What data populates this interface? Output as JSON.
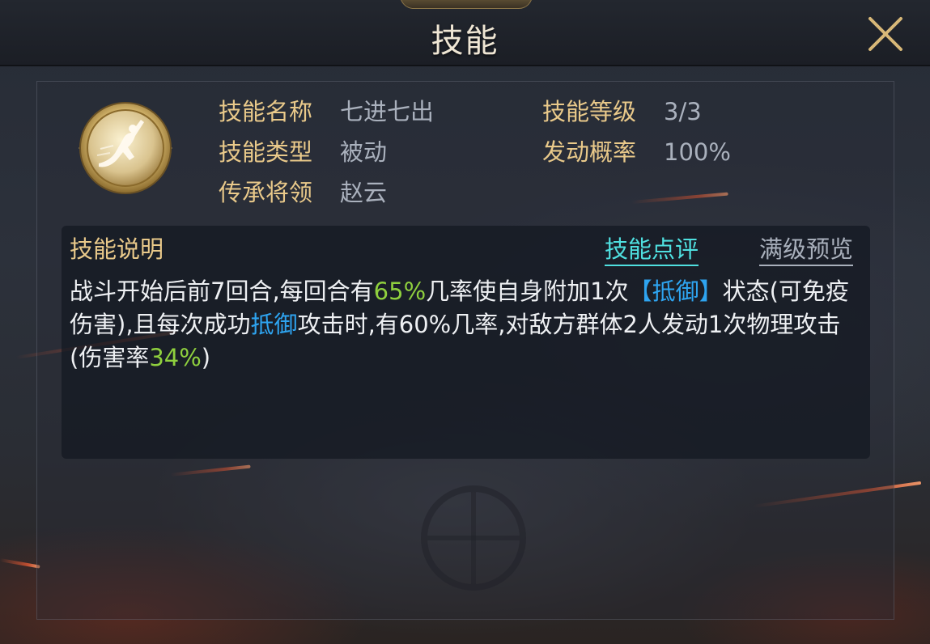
{
  "header": {
    "title": "技能"
  },
  "skill": {
    "name_label": "技能名称",
    "name_value": "七进七出",
    "level_label": "技能等级",
    "level_value": "3/3",
    "type_label": "技能类型",
    "type_value": "被动",
    "trigger_label": "发动概率",
    "trigger_value": "100%",
    "heir_label": "传承将领",
    "heir_value": "赵云"
  },
  "description": {
    "heading": "技能说明",
    "review_link": "技能点评",
    "maxlevel_link": "满级预览",
    "segments": [
      {
        "text": "战斗开始后前7回合,每回合有",
        "style": "normal"
      },
      {
        "text": "65%",
        "style": "green"
      },
      {
        "text": "几率使自身附加1次",
        "style": "normal"
      },
      {
        "text": "【抵御】",
        "style": "blue"
      },
      {
        "text": "状态(可免疫伤害),且每次成功",
        "style": "normal"
      },
      {
        "text": "抵御",
        "style": "blue"
      },
      {
        "text": "攻击时,有60%几率,对敌方群体2人发动1次物理攻击(伤害率",
        "style": "normal"
      },
      {
        "text": "34%",
        "style": "green"
      },
      {
        "text": ")",
        "style": "normal"
      }
    ]
  },
  "icons": {
    "close": "close-icon",
    "skill": "swordsman-skill-icon"
  },
  "colors": {
    "label": "#e9c98a",
    "value": "#aab1bd",
    "highlight_green": "#8fd03e",
    "highlight_blue": "#2ea4f0",
    "link_review": "#4fe0e0"
  }
}
